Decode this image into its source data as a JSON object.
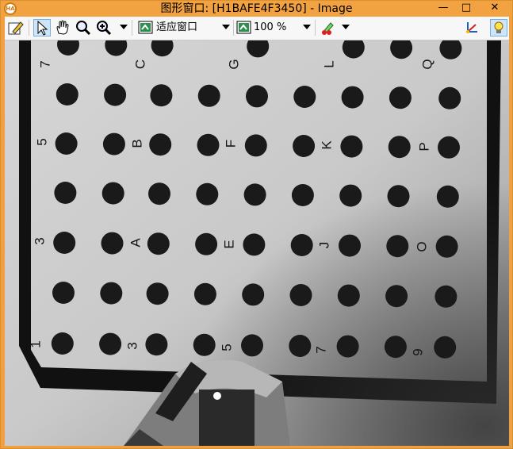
{
  "window": {
    "title": "图形窗口: [H1BAFE4F3450] - Image",
    "app_icon_text": "HA",
    "min_glyph": "—",
    "max_glyph": "□",
    "close_glyph": "✕"
  },
  "toolbar": {
    "zoom_fit_value": "适应窗口",
    "zoom_percent_value": "100 %",
    "icons": [
      "pencil-icon",
      "pointer-icon",
      "hand-icon",
      "magnifier-icon",
      "zoom-in-icon",
      "fit-window-icon",
      "zoom-percent-icon",
      "color-picker-icon",
      "axes-icon",
      "light-bulb-icon"
    ]
  },
  "image": {
    "letters": [
      {
        "text": "B"
      },
      {
        "text": "F"
      },
      {
        "text": "K"
      },
      {
        "text": "P"
      },
      {
        "text": "A"
      },
      {
        "text": "E"
      },
      {
        "text": "J"
      },
      {
        "text": "O"
      },
      {
        "text": "7"
      },
      {
        "text": "C"
      },
      {
        "text": "G"
      },
      {
        "text": "L"
      },
      {
        "text": "Q"
      }
    ],
    "numbers": [
      {
        "text": "5"
      },
      {
        "text": "3"
      },
      {
        "text": "1"
      },
      {
        "text": "3"
      },
      {
        "text": "5"
      },
      {
        "text": "7"
      },
      {
        "text": "9"
      }
    ]
  }
}
